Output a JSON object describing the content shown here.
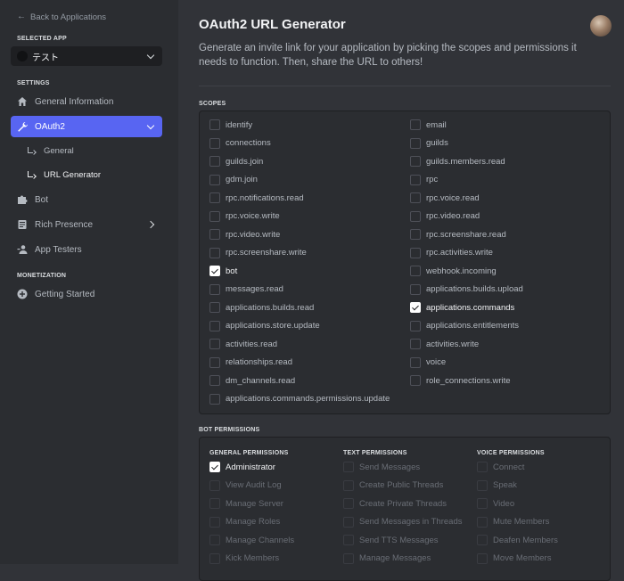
{
  "sidebar": {
    "back_label": "Back to Applications",
    "selected_app_label": "SELECTED APP",
    "app_name": "テスト",
    "settings_label": "SETTINGS",
    "items": [
      {
        "label": "General Information",
        "icon": "home-icon"
      },
      {
        "label": "OAuth2",
        "icon": "wrench-icon"
      },
      {
        "label": "Bot",
        "icon": "puzzle-icon"
      },
      {
        "label": "Rich Presence",
        "icon": "document-icon"
      },
      {
        "label": "App Testers",
        "icon": "person-icon"
      }
    ],
    "subitems": [
      {
        "label": "General"
      },
      {
        "label": "URL Generator"
      }
    ],
    "monetization_label": "MONETIZATION",
    "monetization_items": [
      {
        "label": "Getting Started",
        "icon": "plus-circle-icon"
      }
    ]
  },
  "main": {
    "title": "OAuth2 URL Generator",
    "description": "Generate an invite link for your application by picking the scopes and permissions it needs to function. Then, share the URL to others!",
    "scopes_label": "SCOPES",
    "scopes": [
      {
        "label": "identify",
        "checked": false
      },
      {
        "label": "email",
        "checked": false
      },
      {
        "label": "connections",
        "checked": false
      },
      {
        "label": "guilds",
        "checked": false
      },
      {
        "label": "guilds.join",
        "checked": false
      },
      {
        "label": "guilds.members.read",
        "checked": false
      },
      {
        "label": "gdm.join",
        "checked": false
      },
      {
        "label": "rpc",
        "checked": false
      },
      {
        "label": "rpc.notifications.read",
        "checked": false
      },
      {
        "label": "rpc.voice.read",
        "checked": false
      },
      {
        "label": "rpc.voice.write",
        "checked": false
      },
      {
        "label": "rpc.video.read",
        "checked": false
      },
      {
        "label": "rpc.video.write",
        "checked": false
      },
      {
        "label": "rpc.screenshare.read",
        "checked": false
      },
      {
        "label": "rpc.screenshare.write",
        "checked": false
      },
      {
        "label": "rpc.activities.write",
        "checked": false
      },
      {
        "label": "bot",
        "checked": true
      },
      {
        "label": "webhook.incoming",
        "checked": false
      },
      {
        "label": "messages.read",
        "checked": false
      },
      {
        "label": "applications.builds.upload",
        "checked": false
      },
      {
        "label": "applications.builds.read",
        "checked": false
      },
      {
        "label": "applications.commands",
        "checked": true
      },
      {
        "label": "applications.store.update",
        "checked": false
      },
      {
        "label": "applications.entitlements",
        "checked": false
      },
      {
        "label": "activities.read",
        "checked": false
      },
      {
        "label": "activities.write",
        "checked": false
      },
      {
        "label": "relationships.read",
        "checked": false
      },
      {
        "label": "voice",
        "checked": false
      },
      {
        "label": "dm_channels.read",
        "checked": false
      },
      {
        "label": "role_connections.write",
        "checked": false
      },
      {
        "label": "applications.commands.permissions.update",
        "checked": false
      }
    ],
    "bot_permissions_label": "BOT PERMISSIONS",
    "permission_groups": [
      {
        "heading": "GENERAL PERMISSIONS",
        "items": [
          {
            "label": "Administrator",
            "checked": true,
            "disabled": false
          },
          {
            "label": "View Audit Log",
            "checked": false,
            "disabled": true
          },
          {
            "label": "Manage Server",
            "checked": false,
            "disabled": true
          },
          {
            "label": "Manage Roles",
            "checked": false,
            "disabled": true
          },
          {
            "label": "Manage Channels",
            "checked": false,
            "disabled": true
          },
          {
            "label": "Kick Members",
            "checked": false,
            "disabled": true
          }
        ]
      },
      {
        "heading": "TEXT PERMISSIONS",
        "items": [
          {
            "label": "Send Messages",
            "checked": false,
            "disabled": true
          },
          {
            "label": "Create Public Threads",
            "checked": false,
            "disabled": true
          },
          {
            "label": "Create Private Threads",
            "checked": false,
            "disabled": true
          },
          {
            "label": "Send Messages in Threads",
            "checked": false,
            "disabled": true
          },
          {
            "label": "Send TTS Messages",
            "checked": false,
            "disabled": true
          },
          {
            "label": "Manage Messages",
            "checked": false,
            "disabled": true
          }
        ]
      },
      {
        "heading": "VOICE PERMISSIONS",
        "items": [
          {
            "label": "Connect",
            "checked": false,
            "disabled": true
          },
          {
            "label": "Speak",
            "checked": false,
            "disabled": true
          },
          {
            "label": "Video",
            "checked": false,
            "disabled": true
          },
          {
            "label": "Mute Members",
            "checked": false,
            "disabled": true
          },
          {
            "label": "Deafen Members",
            "checked": false,
            "disabled": true
          },
          {
            "label": "Move Members",
            "checked": false,
            "disabled": true
          }
        ]
      }
    ]
  },
  "colors": {
    "accent": "#5865f2",
    "sidebar_bg": "#2b2d31",
    "main_bg": "#313338"
  }
}
